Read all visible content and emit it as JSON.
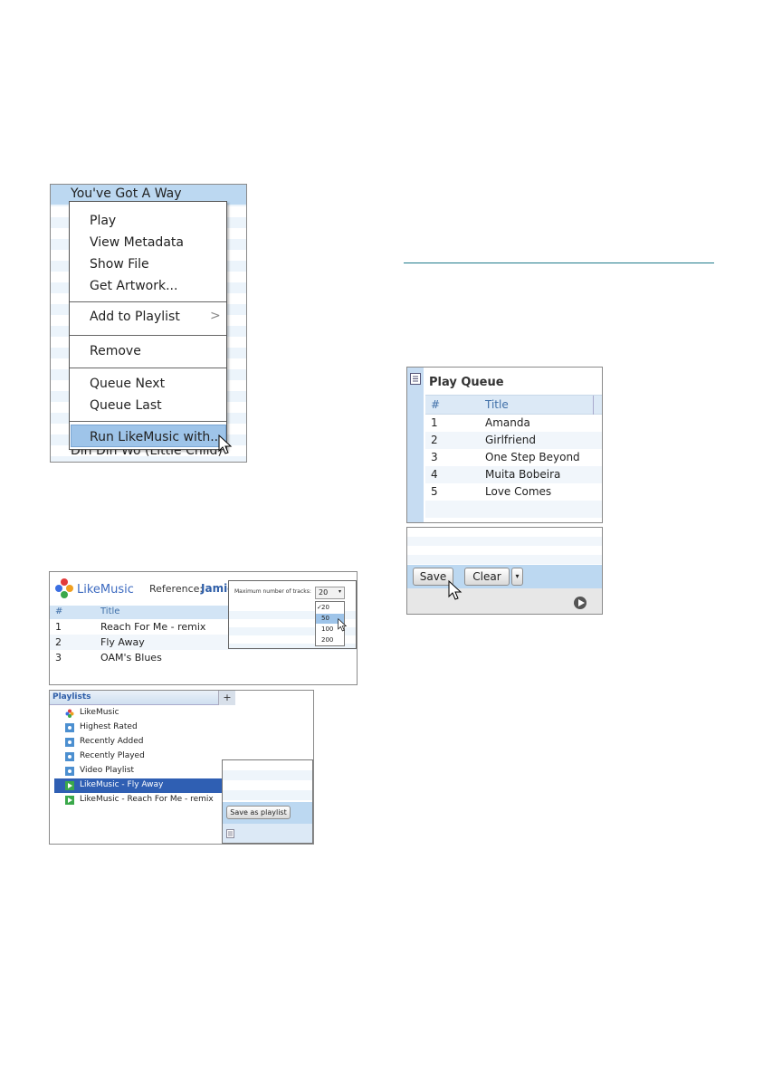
{
  "context_menu": {
    "selected_song": "You've Got A Way",
    "bottom_song": "Din Din Wo (Little Child)",
    "items": [
      "Play",
      "View Metadata",
      "Show File",
      "Get Artwork...",
      "Add to Playlist",
      "Remove",
      "Queue Next",
      "Queue Last",
      "Run LikeMusic with..."
    ],
    "submenu_arrow": ">"
  },
  "play_queue": {
    "title": "Play Queue",
    "columns": [
      "#",
      "Title"
    ],
    "rows": [
      {
        "num": "1",
        "title": "Amanda"
      },
      {
        "num": "2",
        "title": "Girlfriend"
      },
      {
        "num": "3",
        "title": "One Step Beyond"
      },
      {
        "num": "4",
        "title": "Muita Bobeira"
      },
      {
        "num": "5",
        "title": "Love Comes"
      }
    ],
    "save_label": "Save",
    "clear_label": "Clear"
  },
  "likemusic": {
    "brand": "LikeMusic",
    "reference_label": "Reference:",
    "reference_value": "Jamie",
    "columns": [
      "#",
      "Title"
    ],
    "rows": [
      {
        "num": "1",
        "title": "Reach For Me - remix"
      },
      {
        "num": "2",
        "title": "Fly Away"
      },
      {
        "num": "3",
        "title": "OAM's Blues"
      }
    ],
    "max_tracks_label": "Maximum number of tracks:",
    "max_tracks_value": "20",
    "max_tracks_options": [
      "20",
      "50",
      "100",
      "200"
    ]
  },
  "playlists": {
    "header": "Playlists",
    "add_symbol": "+",
    "items": [
      {
        "label": "LikeMusic",
        "icon": "likemusic-icon"
      },
      {
        "label": "Highest Rated",
        "icon": "smart-playlist-icon"
      },
      {
        "label": "Recently Added",
        "icon": "smart-playlist-icon"
      },
      {
        "label": "Recently Played",
        "icon": "smart-playlist-icon"
      },
      {
        "label": "Video Playlist",
        "icon": "smart-playlist-icon"
      },
      {
        "label": "LikeMusic - Fly Away",
        "icon": "playlist-icon"
      },
      {
        "label": "LikeMusic - Reach For Me - remix",
        "icon": "playlist-icon"
      }
    ],
    "save_as_playlist_label": "Save as playlist"
  },
  "colors": {
    "selection": "#2f5fb3",
    "highlight": "#bcd8f1",
    "rule": "#1e7a8a"
  }
}
